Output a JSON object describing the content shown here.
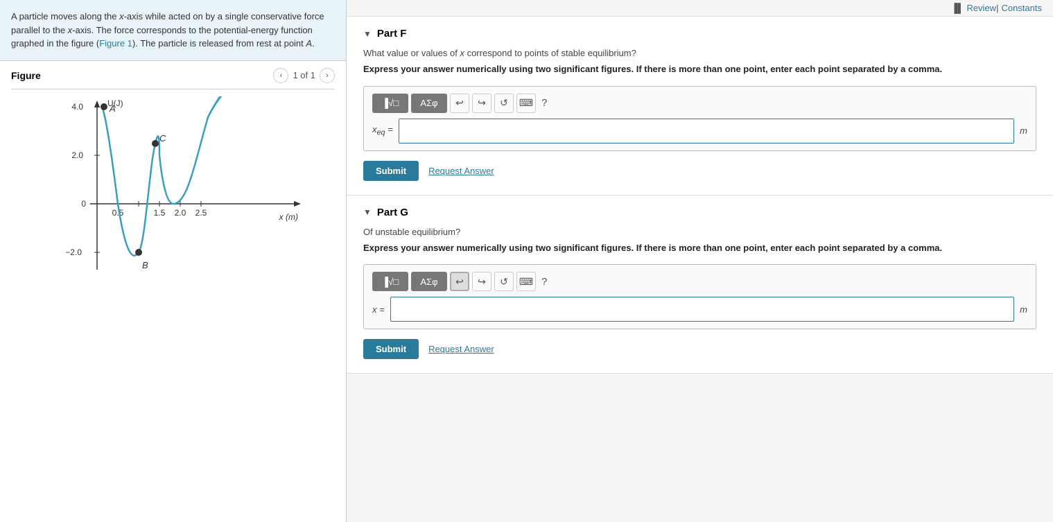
{
  "header": {
    "review_label": "Review",
    "separator": "|",
    "constants_label": "Constants"
  },
  "problem": {
    "text_parts": [
      "A particle moves along the ",
      "x",
      "-axis while acted on by a single conservative force parallel to the ",
      "x",
      "-axis. The force corresponds to the potential-energy function graphed in the figure (",
      "Figure 1",
      "). The particle is released from rest at point ",
      "A",
      "."
    ],
    "full_text": "A particle moves along the x-axis while acted on by a single conservative force parallel to the x-axis. The force corresponds to the potential-energy function graphed in the figure (Figure 1). The particle is released from rest at point A."
  },
  "figure": {
    "title": "Figure",
    "nav_prev": "‹",
    "nav_next": "›",
    "page_indicator": "1 of 1",
    "graph": {
      "y_label": "U(J)",
      "x_label": "x (m)",
      "y_values": [
        "4.0",
        "2.0",
        "0",
        "−2.0"
      ],
      "x_values": [
        "0.5",
        "1.5",
        "2.0",
        "2.5"
      ],
      "points": [
        {
          "label": "A",
          "x": 0.15,
          "y": 4.0
        },
        {
          "label": "B",
          "x": 1.0,
          "y": -2.0
        },
        {
          "label": "C",
          "x": 1.4,
          "y": 2.5
        }
      ]
    }
  },
  "part_f": {
    "label": "Part F",
    "question": "What value or values of x correspond to points of stable equilibrium?",
    "instruction": "Express your answer numerically using two significant figures. If there is more than one point, enter each point separated by a comma.",
    "input_label": "xₚeq =",
    "unit": "m",
    "submit_label": "Submit",
    "request_label": "Request Answer",
    "toolbar": {
      "formula_btn": "√□",
      "symbol_btn": "ΑΣφ",
      "undo": "↩",
      "redo": "↪",
      "reset": "↺",
      "keyboard": "⌨",
      "help": "?"
    }
  },
  "part_g": {
    "label": "Part G",
    "question": "Of unstable equilibrium?",
    "instruction": "Express your answer numerically using two significant figures. If there is more than one point, enter each point separated by a comma.",
    "input_label": "x =",
    "unit": "m",
    "submit_label": "Submit",
    "request_label": "Request Answer",
    "toolbar": {
      "formula_btn": "√□",
      "symbol_btn": "ΑΣφ",
      "undo": "↩",
      "redo": "↪",
      "reset": "↺",
      "keyboard": "⌨",
      "help": "?"
    }
  }
}
